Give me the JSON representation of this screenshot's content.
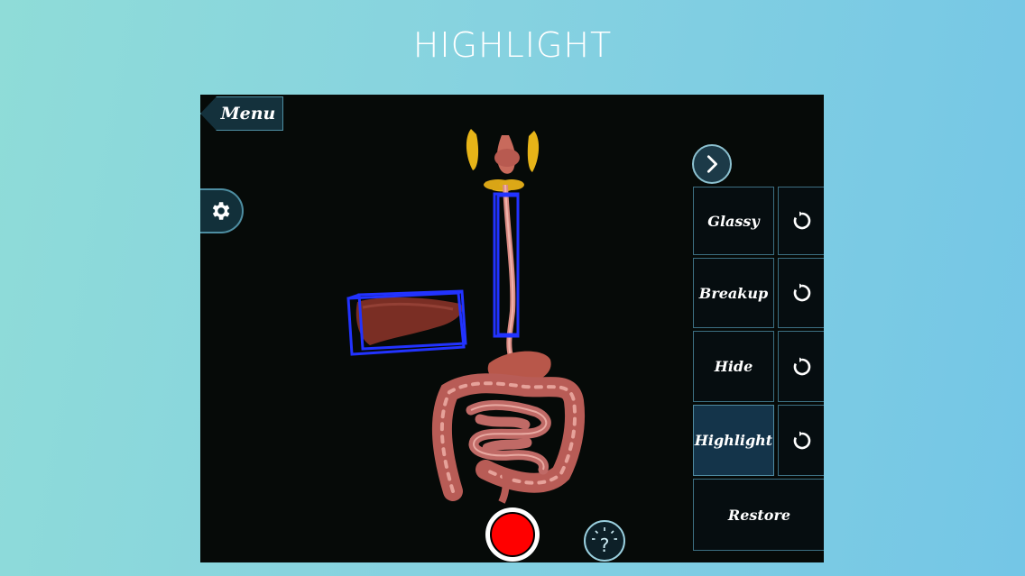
{
  "headline": "HIGHLIGHT",
  "menu": {
    "label": "Menu"
  },
  "icons": {
    "settings": "gear-icon",
    "next": "chevron-right-icon",
    "reset": "refresh-icon",
    "help": "question-bulb-icon",
    "record": "record-icon"
  },
  "panel": {
    "buttons": [
      {
        "label": "Glassy",
        "active": false
      },
      {
        "label": "Breakup",
        "active": false
      },
      {
        "label": "Hide",
        "active": false
      },
      {
        "label": "Highlight",
        "active": true
      }
    ],
    "restore_label": "Restore"
  },
  "colors": {
    "highlight_box": "#2233ff",
    "record": "#ff0000",
    "panel_active": "#14344a"
  }
}
